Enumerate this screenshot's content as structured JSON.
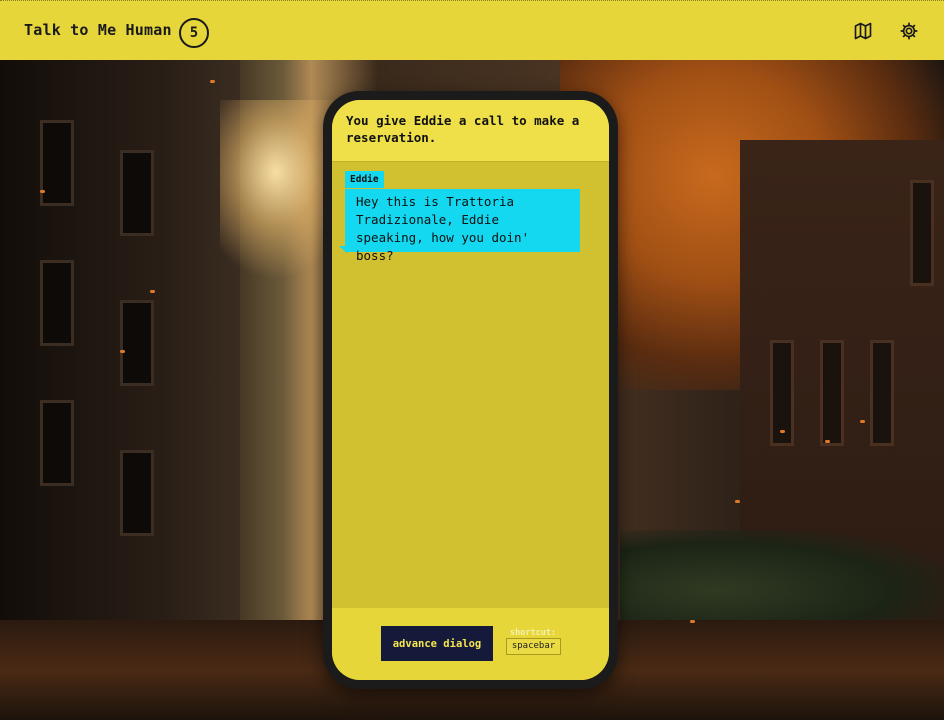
{
  "header": {
    "title": "Talk to Me Human",
    "level": "5",
    "icons": [
      "map-icon",
      "gear-icon"
    ]
  },
  "dialog": {
    "narration": "You give Eddie a call to make a reservation.",
    "speaker": "Eddie",
    "message": "Hey this is Trattoria Tradizionale, Eddie speaking, how you doin' boss?"
  },
  "controls": {
    "advance_label": "advance dialog",
    "shortcut_label": "shortcut:",
    "shortcut_key": "spacebar"
  },
  "colors": {
    "header_bg": "#e6d63a",
    "bubble": "#13d8f0",
    "button_bg": "#161a3a",
    "screen_bg": "#d1c030"
  }
}
